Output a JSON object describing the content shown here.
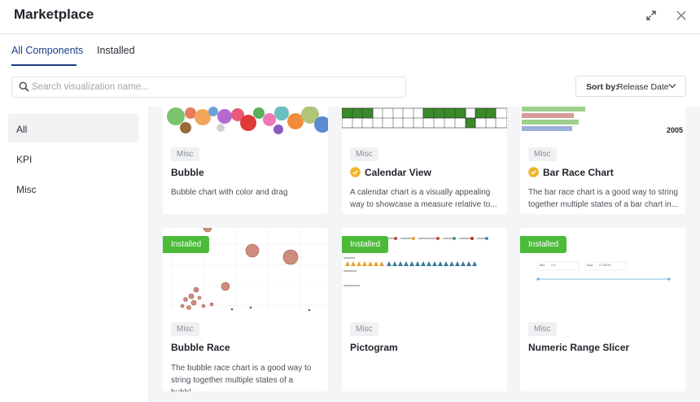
{
  "header": {
    "title": "Marketplace"
  },
  "tabs": [
    {
      "label": "All Components",
      "active": true
    },
    {
      "label": "Installed",
      "active": false
    }
  ],
  "search": {
    "placeholder": "Search visualization name...",
    "value": ""
  },
  "sort": {
    "label": "Sort by:",
    "value": "Release Date"
  },
  "sidebar": {
    "items": [
      {
        "label": "All",
        "active": true
      },
      {
        "label": "KPI",
        "active": false
      },
      {
        "label": "Misc",
        "active": false
      }
    ]
  },
  "cards": [
    {
      "tag": "Misc",
      "title": "Bubble",
      "verified": false,
      "installed": false,
      "description": "Bubble chart with color and drag"
    },
    {
      "tag": "Misc",
      "title": "Calendar View",
      "verified": true,
      "installed": false,
      "description": "A calendar chart is a visually appealing way to showcase a measure relative to..."
    },
    {
      "tag": "Misc",
      "title": "Bar Race Chart",
      "verified": true,
      "installed": false,
      "description": "The bar race chart is a good way to string together multiple states of a bar chart in...",
      "preview_year": "2005"
    },
    {
      "tag": "Misc",
      "title": "Bubble Race",
      "verified": false,
      "installed": true,
      "description": "The bubble race chart is a good way to string together multiple states of a bubbl..."
    },
    {
      "tag": "Misc",
      "title": "Pictogram",
      "verified": false,
      "installed": true,
      "description": ""
    },
    {
      "tag": "Misc",
      "title": "Numeric Range Slicer",
      "verified": false,
      "installed": true,
      "description": "",
      "preview_min_label": "Min",
      "preview_min": "0.4",
      "preview_max_label": "Max",
      "preview_max": "77.05.00"
    }
  ],
  "installed_label": "Installed",
  "colors": {
    "accent": "#1b3d86",
    "installed": "#4cbb3a",
    "verified": "#f0b429",
    "calendar_green": "#3a8a2a"
  }
}
